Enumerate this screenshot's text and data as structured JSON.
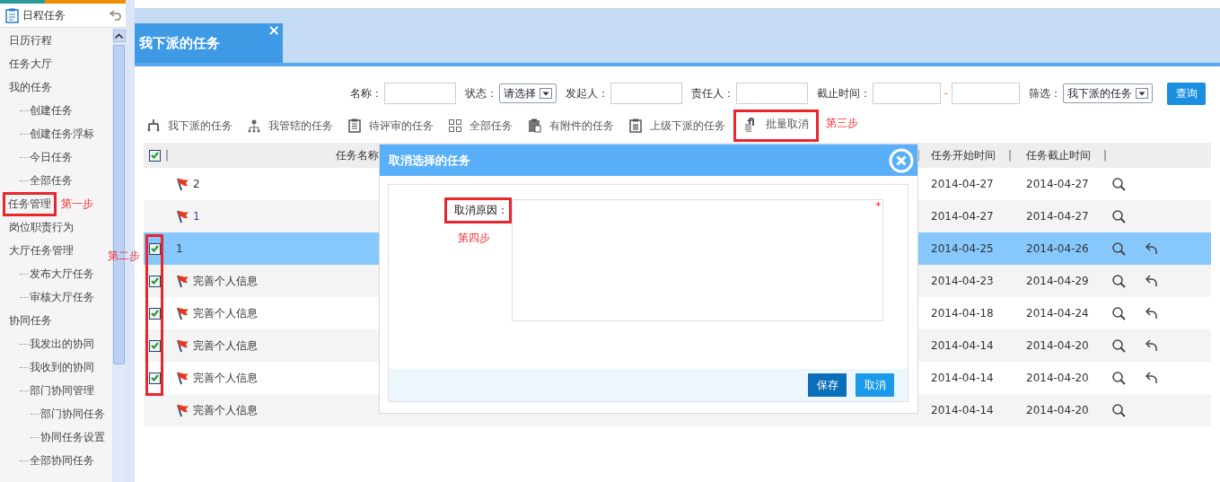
{
  "sidebar": {
    "title": "日程任务",
    "items": [
      {
        "label": "日历行程"
      },
      {
        "label": "任务大厅"
      },
      {
        "label": "我的任务",
        "children": [
          {
            "label": "创建任务"
          },
          {
            "label": "创建任务浮标"
          },
          {
            "label": "今日任务"
          },
          {
            "label": "全部任务"
          }
        ]
      },
      {
        "label": "任务管理"
      },
      {
        "label": "岗位职责行为"
      },
      {
        "label": "大厅任务管理",
        "children": [
          {
            "label": "发布大厅任务"
          },
          {
            "label": "审核大厅任务"
          }
        ]
      },
      {
        "label": "协同任务",
        "children": [
          {
            "label": "我发出的协同"
          },
          {
            "label": "我收到的协同"
          },
          {
            "label": "部门协同管理",
            "children": [
              {
                "label": "部门协同任务"
              },
              {
                "label": "协同任务设置"
              }
            ]
          },
          {
            "label": "全部协同任务"
          }
        ]
      }
    ]
  },
  "tab": {
    "label": "我下派的任务",
    "close": "×"
  },
  "filters": [
    {
      "kind": "input",
      "label": "名称："
    },
    {
      "kind": "select",
      "label": "状态：",
      "value": "请选择"
    },
    {
      "kind": "input",
      "label": "发起人："
    },
    {
      "kind": "input",
      "label": "责任人："
    },
    {
      "kind": "range",
      "label": "截止时间：",
      "separator": "-"
    },
    {
      "kind": "select",
      "label": "筛选：",
      "value": "我下派的任务"
    }
  ],
  "search_button": "查询",
  "toolbar": [
    {
      "kind": "tree",
      "label": "我下派的任务"
    },
    {
      "kind": "org",
      "label": "我管辖的任务"
    },
    {
      "kind": "clipboard",
      "label": "待评审的任务"
    },
    {
      "kind": "grid",
      "label": "全部任务"
    },
    {
      "kind": "attachment",
      "label": "有附件的任务"
    },
    {
      "kind": "building",
      "label": "上级下派的任务"
    },
    {
      "kind": "undo",
      "label": "批量取消"
    }
  ],
  "table": {
    "header_checked": true,
    "header_separator": "|",
    "columns": [
      "任务名称",
      "任务开始时间",
      "任务截止时间"
    ],
    "rows": [
      {
        "name": "2",
        "flag": true,
        "visited": false,
        "checkable": false,
        "selected": false,
        "start": "2014-04-27",
        "end": "2014-04-27",
        "revoke": false
      },
      {
        "name": "1",
        "flag": true,
        "visited": true,
        "checkable": false,
        "selected": false,
        "start": "2014-04-27",
        "end": "2014-04-27",
        "revoke": false
      },
      {
        "name": "1",
        "flag": false,
        "visited": false,
        "checkable": true,
        "checked": true,
        "selected": true,
        "start": "2014-04-25",
        "end": "2014-04-26",
        "revoke": true
      },
      {
        "name": "完善个人信息",
        "flag": true,
        "visited": false,
        "checkable": true,
        "checked": true,
        "selected": false,
        "start": "2014-04-23",
        "end": "2014-04-29",
        "revoke": true
      },
      {
        "name": "完善个人信息",
        "flag": true,
        "visited": false,
        "checkable": true,
        "checked": true,
        "selected": false,
        "start": "2014-04-18",
        "end": "2014-04-24",
        "revoke": true
      },
      {
        "name": "完善个人信息",
        "flag": true,
        "visited": false,
        "checkable": true,
        "checked": true,
        "selected": false,
        "start": "2014-04-14",
        "end": "2014-04-20",
        "revoke": true
      },
      {
        "name": "完善个人信息",
        "flag": true,
        "visited": false,
        "checkable": true,
        "checked": true,
        "selected": false,
        "start": "2014-04-14",
        "end": "2014-04-20",
        "revoke": true
      },
      {
        "name": "完善个人信息",
        "flag": true,
        "visited": false,
        "checkable": false,
        "selected": false,
        "start": "2014-04-14",
        "end": "2014-04-20",
        "revoke": false
      }
    ]
  },
  "dialog": {
    "title": "取消选择的任务",
    "label": "取消原因：",
    "required": "*",
    "buttons": [
      {
        "kind": "primary",
        "label": "保存"
      },
      {
        "kind": "secondary",
        "label": "取消"
      }
    ]
  },
  "annotations": [
    "第一步",
    "第二步",
    "第三步",
    "第四步"
  ]
}
